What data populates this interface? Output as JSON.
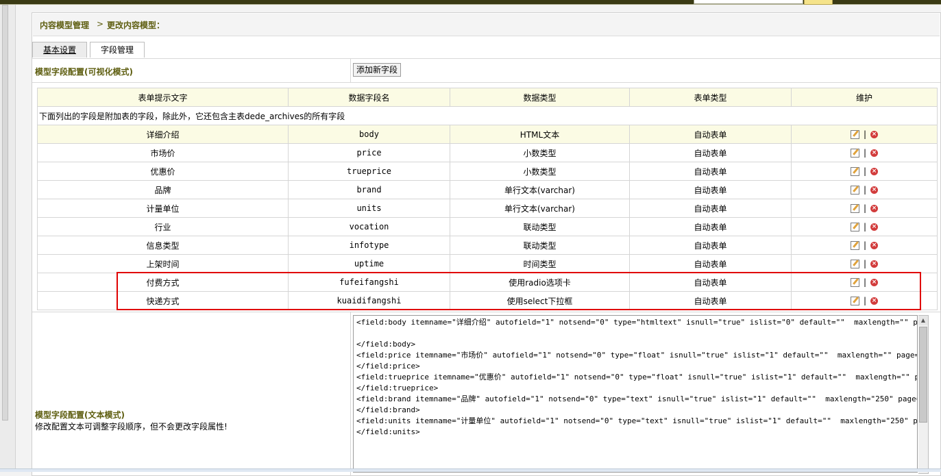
{
  "breadcrumb": {
    "part1": "内容模型管理",
    "sep": ">",
    "part2": "更改内容模型："
  },
  "tabs": [
    {
      "label": "基本设置"
    },
    {
      "label": "字段管理"
    }
  ],
  "section": {
    "title": "模型字段配置(可视化模式)",
    "add_button": "添加新字段"
  },
  "table": {
    "headers": [
      "表单提示文字",
      "数据字段名",
      "数据类型",
      "表单类型",
      "维护"
    ],
    "note": "下面列出的字段是附加表的字段，除此外，它还包含主表dede_archives的所有字段",
    "rows": [
      [
        "详细介绍",
        "body",
        "HTML文本",
        "自动表单"
      ],
      [
        "市场价",
        "price",
        "小数类型",
        "自动表单"
      ],
      [
        "优惠价",
        "trueprice",
        "小数类型",
        "自动表单"
      ],
      [
        "品牌",
        "brand",
        "单行文本(varchar)",
        "自动表单"
      ],
      [
        "计量单位",
        "units",
        "单行文本(varchar)",
        "自动表单"
      ],
      [
        "行业",
        "vocation",
        "联动类型",
        "自动表单"
      ],
      [
        "信息类型",
        "infotype",
        "联动类型",
        "自动表单"
      ],
      [
        "上架时间",
        "uptime",
        "时间类型",
        "自动表单"
      ],
      [
        "付费方式",
        "fufeifangshi",
        "使用radio选项卡",
        "自动表单"
      ],
      [
        "快递方式",
        "kuaidifangshi",
        "使用select下拉框",
        "自动表单"
      ]
    ],
    "action_sep": "|",
    "delete_glyph": "×"
  },
  "text_mode": {
    "title": "模型字段配置(文本模式)",
    "desc": "修改配置文本可调整字段顺序，但不会更改字段属性!",
    "config_text": "<field:body itemname=\"详细介绍\" autofield=\"1\" notsend=\"0\" type=\"htmltext\" isnull=\"true\" islist=\"0\" default=\"\"  maxlength=\"\" page=\"split\">\n\n</field:body>\n<field:price itemname=\"市场价\" autofield=\"1\" notsend=\"0\" type=\"float\" isnull=\"true\" islist=\"1\" default=\"\"  maxlength=\"\" page=\"\">\n</field:price>\n<field:trueprice itemname=\"优惠价\" autofield=\"1\" notsend=\"0\" type=\"float\" isnull=\"true\" islist=\"1\" default=\"\"  maxlength=\"\" page=\"\">\n</field:trueprice>\n<field:brand itemname=\"品牌\" autofield=\"1\" notsend=\"0\" type=\"text\" isnull=\"true\" islist=\"1\" default=\"\"  maxlength=\"250\" page=\"\">\n</field:brand>\n<field:units itemname=\"计量单位\" autofield=\"1\" notsend=\"0\" type=\"text\" isnull=\"true\" islist=\"1\" default=\"\"  maxlength=\"250\" page=\"\">\n</field:units>"
  },
  "colors": {
    "accent_text": "#5e5e10",
    "header_bg": "#fbfbe4",
    "highlight_border": "#e00000"
  }
}
